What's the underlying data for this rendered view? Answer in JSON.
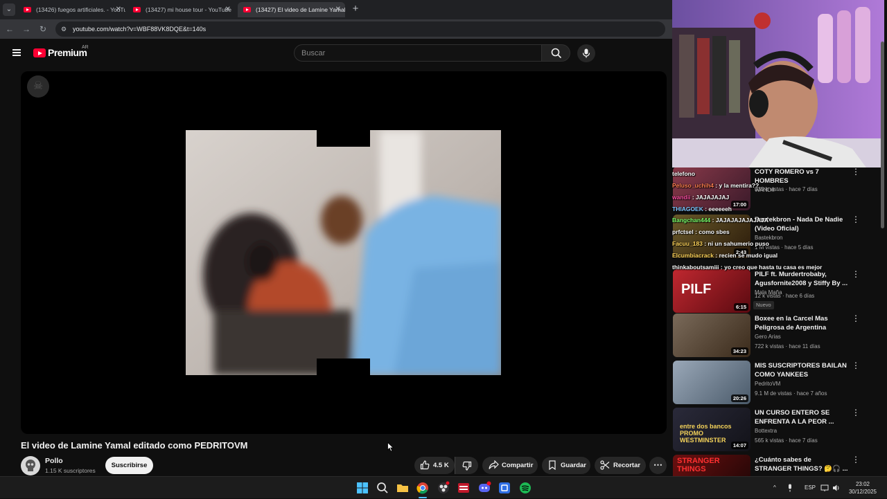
{
  "browser": {
    "tabs": [
      {
        "title": "(13426) fuegos artificiales. - YouTube",
        "active": false
      },
      {
        "title": "(13427) mi house tour - YouTube",
        "active": false
      },
      {
        "title": "(13427) El video de Lamine Yamal editado como PEDRITOVM",
        "active": true
      }
    ],
    "url": "youtube.com/watch?v=WBF88VK8DQE&t=140s"
  },
  "header": {
    "logo": "Premium",
    "country": "AR",
    "search_placeholder": "Buscar"
  },
  "video": {
    "title": "El video de Lamine Yamal editado como PEDRITOVM",
    "channel": "Pollo",
    "subscribers": "1.15 K suscriptores",
    "subscribe_label": "Suscribirse",
    "likes": "4.5 K",
    "share_label": "Compartir",
    "save_label": "Guardar",
    "clip_label": "Recortar"
  },
  "recommendations": [
    {
      "title": "COTY ROMERO vs 7 HOMBRES",
      "channel": "WANDII",
      "meta": "333 k vistas · hace 7 días",
      "duration": "17:00",
      "thumb_color": "#8a3a4a"
    },
    {
      "title": "Bastekbron - Nada De Nadie (Video Oficial)",
      "channel": "Bastekbron",
      "meta": "1 M vistas · hace 5 días",
      "duration": "2:43",
      "thumb_color": "#5a4a2a"
    },
    {
      "title": "PILF ft. Murdertrobaby, Agusfornite2008 y Stiffy By ...",
      "channel": "Mala Maña",
      "meta": "12 k vistas · hace 6 días",
      "duration": "6:15",
      "badge": "Nuevo",
      "thumb_text": "PILF",
      "thumb_color": "#b0202a"
    },
    {
      "title": "Boxee en la Carcel Mas Peligrosa de Argentina",
      "channel": "Gero Arias",
      "meta": "722 k vistas · hace 11 días",
      "duration": "34:23",
      "thumb_color": "#6b5b4b"
    },
    {
      "title": "MIS SUSCRIPTORES BAILAN COMO YANKEES",
      "channel": "PedritoVM",
      "meta": "9.1 M de vistas · hace 7 años",
      "duration": "20:26",
      "thumb_color": "#7a8a9a"
    },
    {
      "title": "UN CURSO ENTERO SE ENFRENTA A LA PEOR ...",
      "channel": "Bottextra",
      "meta": "565 k vistas · hace 7 días",
      "duration": "14:07",
      "thumb_text": "entre dos bancos PROMO WESTMINSTER",
      "thumb_color": "#2a2a3a"
    },
    {
      "title": "¿Cuánto sabes de STRANGER THINGS? 🤔🎧 ... Nivel ...",
      "channel": "",
      "meta": "",
      "duration": "",
      "thumb_text": "STRANGER THINGS",
      "thumb_color": "#3a0a0a"
    }
  ],
  "chat": [
    {
      "user": "",
      "msg": "telefono",
      "color": "#ffffff"
    },
    {
      "user": "Peluso_uchih4",
      "msg": " : y la mentira??",
      "color": "#ff7f50"
    },
    {
      "user": "wandii",
      "msg": " : JAJAJAJAJ",
      "color": "#ff4fa3"
    },
    {
      "user": "THIAGOEK",
      "msg": " : eeeeeeh",
      "color": "#7ec8ff"
    },
    {
      "user": "Bangchan444",
      "msg": " : JAJAJAJAJAJAJA",
      "color": "#7cff6b"
    },
    {
      "user": "prfctsel",
      "msg": " : como sbes",
      "color": "#ffffff"
    },
    {
      "user": "Facuu_183",
      "msg": " : ni un sahumerio puso",
      "color": "#ffd45a"
    },
    {
      "user": "Elcumbiacrack",
      "msg": " : recien se mudo igual",
      "color": "#ffd45a"
    },
    {
      "user": "thinkaboutsamiii",
      "msg": " : yo creo que hasta tu casa es mejor",
      "color": "#ffffff"
    }
  ],
  "taskbar": {
    "language": "ESP",
    "time": "23:02",
    "date": "30/12/2025"
  }
}
